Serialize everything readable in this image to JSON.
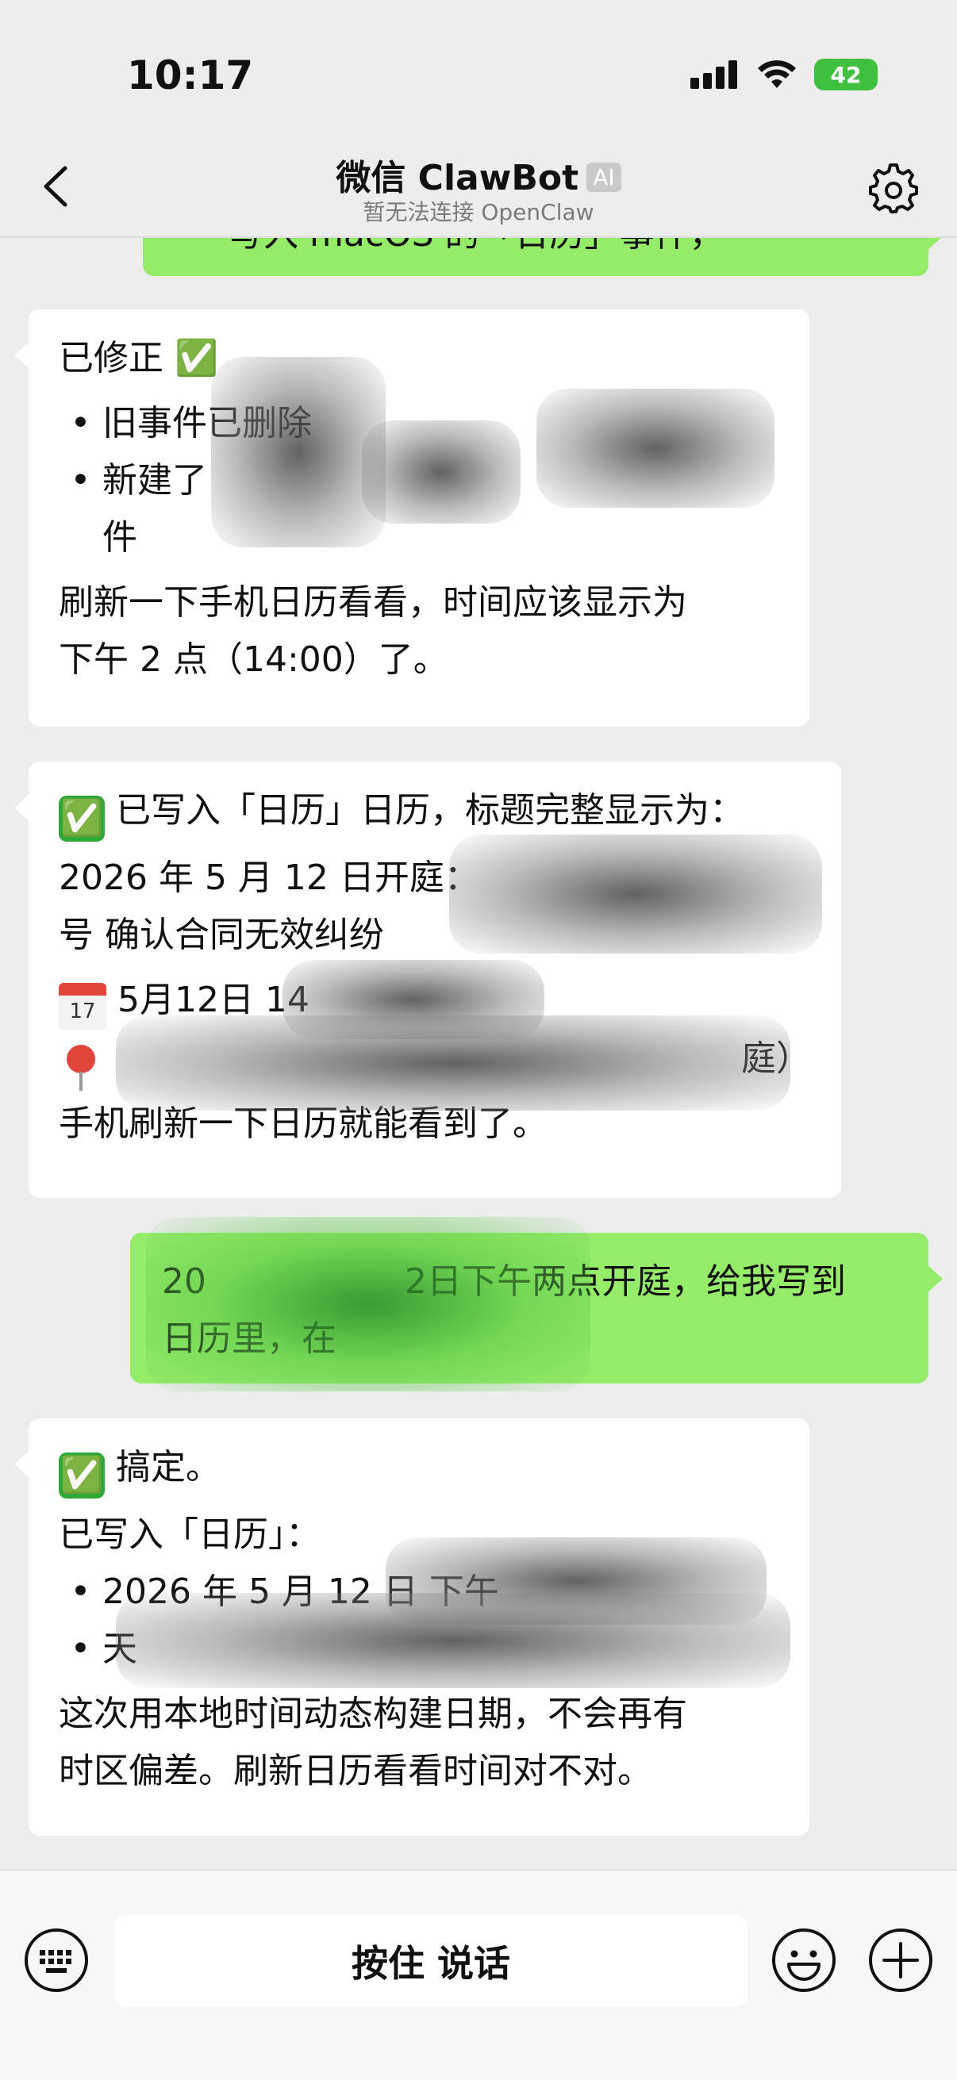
{
  "status": {
    "time": "10:17",
    "battery": "42"
  },
  "header": {
    "title": "微信 ClawBot",
    "badge": "AI",
    "subtitle": "暂无法连接 OpenClaw"
  },
  "messages": {
    "m0": {
      "text": "写入 macOS 的「日历」事件，"
    },
    "m1": {
      "title": "已修正 ✅",
      "bullet1": "旧事件已删除",
      "bullet2": "新建了",
      "bullet2_cont": "件",
      "body1": "刷新一下手机日历看看，时间应该显示为",
      "body2": "下午 2 点（14:00）了。"
    },
    "m2": {
      "check": "✅",
      "title": "已写入「日历」日历，标题完整显示为：",
      "line1": "2026 年 5 月 12 日开庭：",
      "line2": "号 确认合同无效纠纷",
      "cal_icon_month": "JUL",
      "cal_icon_day": "17",
      "date": "5月12日 14",
      "location_tail": "庭）",
      "footer": "手机刷新一下日历就能看到了。"
    },
    "m3": {
      "line1_a": "20",
      "line1_b": "2日下午两点开庭，给我写到",
      "line2": "日历里，在"
    },
    "m4": {
      "check": "✅",
      "title": "搞定。",
      "written": "已写入「日历」：",
      "bullet1": "2026 年 5 月 12 日 下午",
      "bullet2": "天",
      "body1": "这次用本地时间动态构建日期，不会再有",
      "body2": "时区偏差。刷新日历看看时间对不对。"
    }
  },
  "input": {
    "talk_label": "按住 说话"
  },
  "icons": {
    "back": "chevron-left-icon",
    "settings": "gear-icon",
    "keyboard": "keyboard-icon",
    "emoji": "smiley-icon",
    "plus": "plus-icon"
  },
  "colors": {
    "outgoing_bubble": "#95ec69",
    "incoming_bubble": "#ffffff",
    "background": "#ededed"
  }
}
